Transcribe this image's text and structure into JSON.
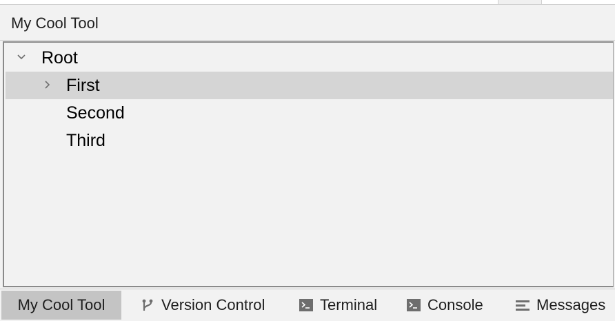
{
  "tool_window": {
    "title": "My Cool Tool"
  },
  "tree": {
    "root_label": "Root",
    "items": [
      {
        "label": "First",
        "expandable": true,
        "selected": true
      },
      {
        "label": "Second",
        "expandable": false,
        "selected": false
      },
      {
        "label": "Third",
        "expandable": false,
        "selected": false
      }
    ]
  },
  "bottom_bar": {
    "tabs": [
      {
        "label": "My Cool Tool",
        "icon": "none",
        "active": true
      },
      {
        "label": "Version Control",
        "icon": "branch-icon",
        "active": false
      },
      {
        "label": "Terminal",
        "icon": "terminal-icon",
        "active": false
      },
      {
        "label": "Console",
        "icon": "console-icon",
        "active": false
      },
      {
        "label": "Messages",
        "icon": "messages-icon",
        "active": false
      }
    ]
  },
  "colors": {
    "background": "#f2f2f2",
    "selection": "#d5d5d5",
    "active_tab": "#c4c4c4",
    "icon": "#6e6e6e"
  }
}
